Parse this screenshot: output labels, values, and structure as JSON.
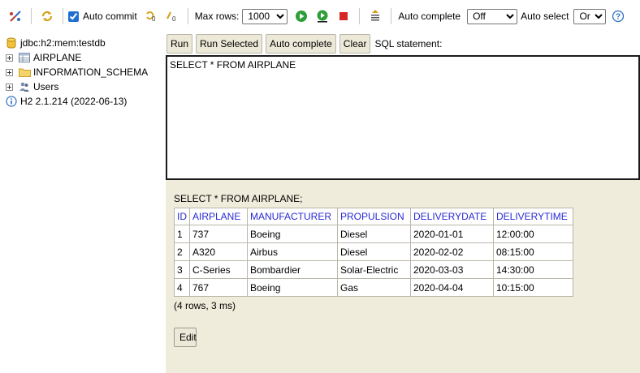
{
  "toolbar": {
    "auto_commit_label": "Auto commit",
    "max_rows_label": "Max rows:",
    "max_rows_value": "1000",
    "auto_complete_label": "Auto complete",
    "auto_complete_value": "Off",
    "auto_select_label": "Auto select",
    "auto_select_value": "On",
    "help_glyph": "?"
  },
  "tree": {
    "connection": "jdbc:h2:mem:testdb",
    "items": [
      {
        "label": "AIRPLANE",
        "icon": "table-icon"
      },
      {
        "label": "INFORMATION_SCHEMA",
        "icon": "folder-icon"
      },
      {
        "label": "Users",
        "icon": "users-icon"
      }
    ],
    "version": "H2 2.1.214 (2022-06-13)"
  },
  "query_buttons": {
    "run": "Run",
    "run_selected": "Run Selected",
    "auto_complete": "Auto complete",
    "clear": "Clear",
    "sql_label": "SQL statement:"
  },
  "sql_text": "SELECT * FROM AIRPLANE",
  "result": {
    "statement": "SELECT * FROM AIRPLANE;",
    "columns": [
      "ID",
      "AIRPLANE",
      "MANUFACTURER",
      "PROPULSION",
      "DELIVERYDATE",
      "DELIVERYTIME"
    ],
    "rows": [
      [
        "1",
        "737",
        "Boeing",
        "Diesel",
        "2020-01-01",
        "12:00:00"
      ],
      [
        "2",
        "A320",
        "Airbus",
        "Diesel",
        "2020-02-02",
        "08:15:00"
      ],
      [
        "3",
        "C-Series",
        "Bombardier",
        "Solar-Electric",
        "2020-03-03",
        "14:30:00"
      ],
      [
        "4",
        "767",
        "Boeing",
        "Gas",
        "2020-04-04",
        "10:15:00"
      ]
    ],
    "row_count": "(4 rows, 3 ms)",
    "edit_label": "Edit"
  },
  "colors": {
    "accent": "#2a2ad6",
    "panel_bg": "#f0ecdc",
    "run_green": "#2e9e3a",
    "stop_red": "#d62626"
  }
}
